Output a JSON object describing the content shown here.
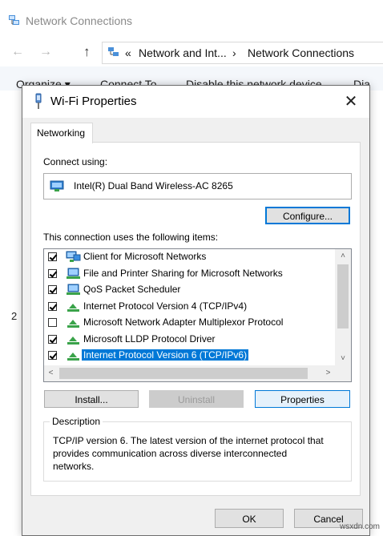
{
  "explorer": {
    "title": "Network Connections",
    "nav": {
      "back": "←",
      "forward": "→",
      "up": "↑"
    },
    "address": {
      "chevrons": "«",
      "crumb1": "Network and Int...",
      "sep": "›",
      "crumb2": "Network Connections"
    },
    "toolbar": {
      "organize": "Organize ▾",
      "connect_to": "Connect To",
      "disable": "Disable this network device",
      "diagnose": "Dia"
    },
    "left_count": "2"
  },
  "dialog": {
    "title": "Wi-Fi Properties",
    "close_glyph": "✕",
    "tab": "Networking",
    "connect_using_label": "Connect using:",
    "adapter_name": "Intel(R) Dual Band Wireless-AC 8265",
    "configure_button": "Configure...",
    "items_label": "This connection uses the following items:",
    "items": [
      {
        "label": "Client for Microsoft Networks",
        "checked": true,
        "icon": "client-icon",
        "selected": false
      },
      {
        "label": "File and Printer Sharing for Microsoft Networks",
        "checked": true,
        "icon": "service-icon",
        "selected": false
      },
      {
        "label": "QoS Packet Scheduler",
        "checked": true,
        "icon": "service-icon",
        "selected": false
      },
      {
        "label": "Internet Protocol Version 4 (TCP/IPv4)",
        "checked": true,
        "icon": "protocol-icon",
        "selected": false
      },
      {
        "label": "Microsoft Network Adapter Multiplexor Protocol",
        "checked": false,
        "icon": "protocol-icon",
        "selected": false
      },
      {
        "label": "Microsoft LLDP Protocol Driver",
        "checked": true,
        "icon": "protocol-icon",
        "selected": false
      },
      {
        "label": "Internet Protocol Version 6 (TCP/IPv6)",
        "checked": true,
        "icon": "protocol-icon",
        "selected": true
      }
    ],
    "scroll": {
      "up": "˄",
      "down": "˅",
      "left": "˂",
      "right": "˃"
    },
    "install_button": "Install...",
    "uninstall_button": "Uninstall",
    "properties_button": "Properties",
    "description_legend": "Description",
    "description_text": "TCP/IP version 6. The latest version of the internet protocol that provides communication across diverse interconnected networks.",
    "ok_button": "OK",
    "cancel_button": "Cancel"
  },
  "watermark": "wsxdn.com",
  "colors": {
    "accent": "#0078d7",
    "dialog_bg": "#f0f0f0"
  }
}
